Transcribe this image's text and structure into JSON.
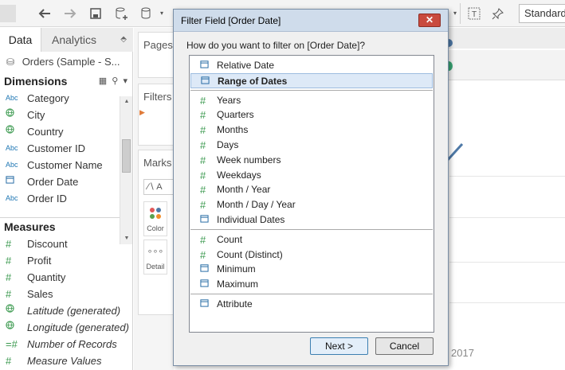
{
  "toolbar": {
    "icons": [
      "back-arrow-icon",
      "forward-arrow-icon",
      "save-icon",
      "add-datasource-icon",
      "datasource-icon",
      "text-label-icon",
      "pin-icon"
    ],
    "fit_label": "Standard"
  },
  "left_pane": {
    "tabs": {
      "data": "Data",
      "analytics": "Analytics"
    },
    "datasource": "Orders (Sample - S...",
    "dimensions_header": "Dimensions",
    "dimensions": [
      {
        "icon": "Abc",
        "label": "Category"
      },
      {
        "icon": "globe",
        "label": "City"
      },
      {
        "icon": "globe",
        "label": "Country"
      },
      {
        "icon": "Abc",
        "label": "Customer ID"
      },
      {
        "icon": "Abc",
        "label": "Customer Name"
      },
      {
        "icon": "calendar",
        "label": "Order Date"
      },
      {
        "icon": "Abc",
        "label": "Order ID"
      }
    ],
    "measures_header": "Measures",
    "measures": [
      {
        "icon": "#",
        "label": "Discount"
      },
      {
        "icon": "#",
        "label": "Profit"
      },
      {
        "icon": "#",
        "label": "Quantity"
      },
      {
        "icon": "#",
        "label": "Sales"
      },
      {
        "icon": "globe",
        "label": "Latitude (generated)"
      },
      {
        "icon": "globe",
        "label": "Longitude (generated)"
      },
      {
        "icon": "=#",
        "label": "Number of Records"
      },
      {
        "icon": "#",
        "label": "Measure Values"
      }
    ]
  },
  "shelves": {
    "pages": "Pages",
    "filters": "Filters",
    "marks": "Marks",
    "marks_type": "A",
    "color": "Color",
    "detail": "Detail"
  },
  "view": {
    "year_label": "2017"
  },
  "dialog": {
    "title": "Filter Field [Order Date]",
    "close": "✕",
    "prompt": "How do you want to filter on [Order Date]?",
    "groups": [
      [
        {
          "icon": "calendar",
          "label": "Relative Date",
          "selected": false
        },
        {
          "icon": "calendar",
          "label": "Range of Dates",
          "selected": true
        }
      ],
      [
        {
          "icon": "#",
          "label": "Years"
        },
        {
          "icon": "#",
          "label": "Quarters"
        },
        {
          "icon": "#",
          "label": "Months"
        },
        {
          "icon": "#",
          "label": "Days"
        },
        {
          "icon": "#",
          "label": "Week numbers"
        },
        {
          "icon": "#",
          "label": "Weekdays"
        },
        {
          "icon": "#",
          "label": "Month / Year"
        },
        {
          "icon": "#",
          "label": "Month / Day / Year"
        },
        {
          "icon": "calendar",
          "label": "Individual Dates"
        }
      ],
      [
        {
          "icon": "#",
          "label": "Count"
        },
        {
          "icon": "#",
          "label": "Count (Distinct)"
        },
        {
          "icon": "calendar",
          "label": "Minimum"
        },
        {
          "icon": "calendar",
          "label": "Maximum"
        }
      ],
      [
        {
          "icon": "calendar",
          "label": "Attribute"
        }
      ]
    ],
    "next_button": "Next >",
    "cancel_button": "Cancel"
  },
  "colors": {
    "accent_selected": "#dde9f7",
    "dimension_icon": "#1f77b4",
    "measure_icon": "#3c9a50",
    "close_button": "#c94a3e"
  }
}
